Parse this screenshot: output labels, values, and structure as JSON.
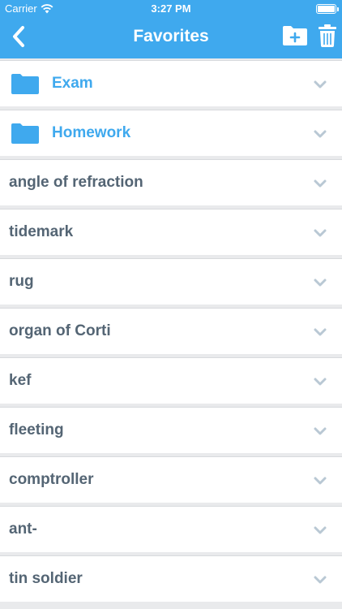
{
  "status_bar": {
    "carrier": "Carrier",
    "time": "3:27 PM",
    "battery_level": 1.0
  },
  "nav": {
    "title": "Favorites",
    "back_icon": "chevron-left-icon",
    "add_folder_icon": "folder-plus-icon",
    "delete_icon": "trash-icon"
  },
  "colors": {
    "header_bg": "#3fa9ee",
    "folder_blue": "#3fa9ee",
    "text_gray": "#546574",
    "chevron": "#b9c8d4",
    "page_bg": "#e9eaec"
  },
  "list": {
    "folders": [
      {
        "label": "Exam",
        "icon": "folder-icon"
      },
      {
        "label": "Homework",
        "icon": "folder-icon"
      }
    ],
    "words": [
      {
        "label": "angle of refraction"
      },
      {
        "label": "tidemark"
      },
      {
        "label": "rug"
      },
      {
        "label": "organ of Corti"
      },
      {
        "label": "kef"
      },
      {
        "label": "fleeting"
      },
      {
        "label": "comptroller"
      },
      {
        "label": "ant-"
      },
      {
        "label": "tin soldier"
      }
    ],
    "expand_icon": "chevron-down-icon"
  }
}
